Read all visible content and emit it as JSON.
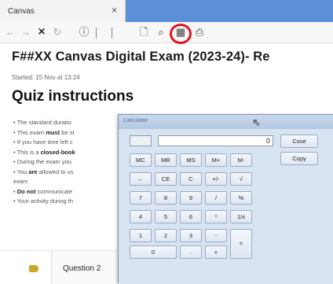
{
  "browser": {
    "tab_title": "Canvas",
    "tab_close": "×",
    "toolbar": {
      "back": "←",
      "forward": "→",
      "stop": "×",
      "reload": "↻",
      "info": "ⓘ",
      "page": "🗋",
      "search": "⌕",
      "calculator": "▦",
      "print": "⎙"
    }
  },
  "page": {
    "title": "F##XX Canvas Digital Exam (2023-24)- Re",
    "started": "Started: 15 Nov at 13:24",
    "section_heading": "Quiz instructions",
    "instructions": [
      {
        "pre": "The standard duratio",
        "bold": "",
        "post": ""
      },
      {
        "pre": "This exam ",
        "bold": "must",
        "post": " be st"
      },
      {
        "pre": "If you have time left c",
        "bold": "",
        "post": ""
      },
      {
        "pre": "This is a ",
        "bold": "closed-book",
        "post": ""
      },
      {
        "pre": "During the exam you",
        "bold": "",
        "post": ""
      },
      {
        "pre": "You ",
        "bold": "are",
        "post": " allowed to us"
      },
      {
        "pre": "exam",
        "bold": "",
        "post": ""
      },
      {
        "pre": "",
        "bold": "Do not",
        "post": " communicate"
      },
      {
        "pre": "Your activity during th",
        "bold": "",
        "post": ""
      }
    ],
    "question_label": "Question 2"
  },
  "calculator": {
    "title": "Calculator",
    "display": "0",
    "keys": {
      "close": "Cose",
      "copy": "Copy",
      "mc": "MC",
      "mr": "MR",
      "ms": "MS",
      "mplus": "M+",
      "mminus": "M-",
      "backspace": "←",
      "ce": "CE",
      "c": "C",
      "plusminus": "+/-",
      "sqrt": "√",
      "k7": "7",
      "k8": "8",
      "k9": "9",
      "divide": "/",
      "percent": "%",
      "k4": "4",
      "k5": "5",
      "k6": "6",
      "multiply": "*",
      "reciprocal": "1/x",
      "k1": "1",
      "k2": "2",
      "k3": "3",
      "minus": "-",
      "equals": "=",
      "k0": "0",
      "decimal": ".",
      "plus": "+"
    }
  },
  "colors": {
    "highlight_ring": "#e0141e",
    "tab_bar": "#5b8fd8",
    "calculator_frame": "#b9cde6",
    "question_marker": "#c8a72a"
  }
}
